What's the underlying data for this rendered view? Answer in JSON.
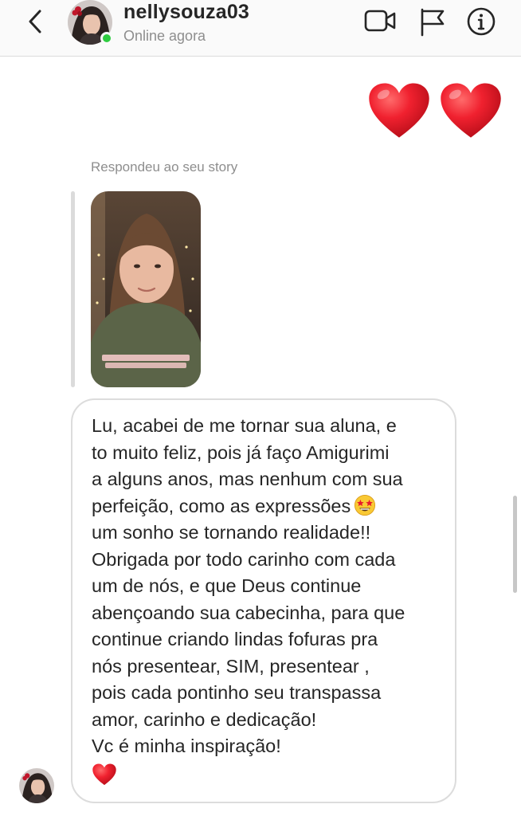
{
  "header": {
    "username": "nellysouza03",
    "status": "Online agora",
    "icons": [
      "back-chevron-icon",
      "video-camera-icon",
      "flag-icon",
      "info-icon"
    ]
  },
  "messages": {
    "sent_hearts": [
      "❤️",
      "❤️"
    ],
    "story_reply_label": "Respondeu ao seu story",
    "received_text_lines": [
      "Lu, acabei de me tornar sua aluna, e",
      "to muito feliz, pois já faço Amigurimi",
      "a alguns anos, mas nenhum com sua",
      "perfeição, como as expressões",
      "um sonho se tornando realidade!!",
      "Obrigada por todo carinho com cada",
      "um de nós, e que Deus continue",
      "abençoando sua cabecinha, para que",
      "continue criando lindas fofuras pra",
      "nós presentear, SIM, presentear ,",
      "pois cada pontinho seu transpassa",
      "amor, carinho e dedicação!",
      "Vc é minha inspiração!"
    ],
    "inline_emoji": "star-struck",
    "closing_emoji": "heart"
  },
  "colors": {
    "online": "#2ecc40",
    "heart": "#e8192c",
    "muted_text": "#8e8e8e",
    "bubble_border": "#dcdcdc"
  }
}
